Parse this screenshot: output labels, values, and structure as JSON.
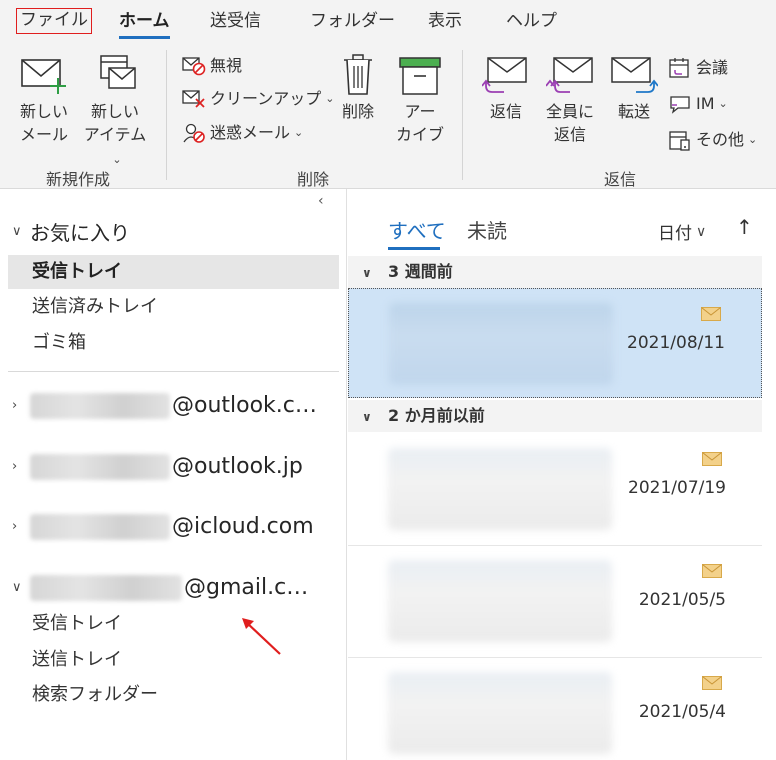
{
  "tabs": {
    "file": "ファイル",
    "home": "ホーム",
    "send_receive": "送受信",
    "folder": "フォルダー",
    "view": "表示",
    "help": "ヘルプ"
  },
  "ribbon": {
    "new_email_l1": "新しい",
    "new_email_l2": "メール",
    "new_items_l1": "新しい",
    "new_items_l2": "アイテム",
    "group_new": "新規作成",
    "ignore": "無視",
    "cleanup": "クリーンアップ",
    "junk": "迷惑メール",
    "delete": "削除",
    "archive_l1": "アー",
    "archive_l2": "カイブ",
    "group_delete": "削除",
    "reply": "返信",
    "reply_all_l1": "全員に",
    "reply_all_l2": "返信",
    "forward": "転送",
    "meeting": "会議",
    "im": "IM",
    "more": "その他",
    "group_respond": "返信"
  },
  "folders": {
    "favorites": "お気に入り",
    "inbox": "受信トレイ",
    "sent": "送信済みトレイ",
    "trash": "ゴミ箱",
    "accounts": [
      {
        "domain": "@outlook.c…"
      },
      {
        "domain": "@outlook.jp"
      },
      {
        "domain": "@icloud.com"
      },
      {
        "domain": "@gmail.c…"
      }
    ],
    "gmail_inbox": "受信トレイ",
    "gmail_sent": "送信トレイ",
    "gmail_search": "検索フォルダー"
  },
  "maillist": {
    "tab_all": "すべて",
    "tab_unread": "未読",
    "sort_label": "日付",
    "groups": [
      {
        "label": "3 週間前"
      },
      {
        "label": "2 か月前以前"
      }
    ],
    "mails": [
      {
        "date": "2021/08/11"
      },
      {
        "date": "2021/07/19"
      },
      {
        "date": "2021/05/5"
      },
      {
        "date": "2021/05/4"
      }
    ]
  },
  "colors": {
    "accent": "#1f6fbf",
    "selected_mail": "#cfe3f6",
    "highlight_box": "#e01e1e",
    "annotation_arrow": "#e01e1e"
  }
}
